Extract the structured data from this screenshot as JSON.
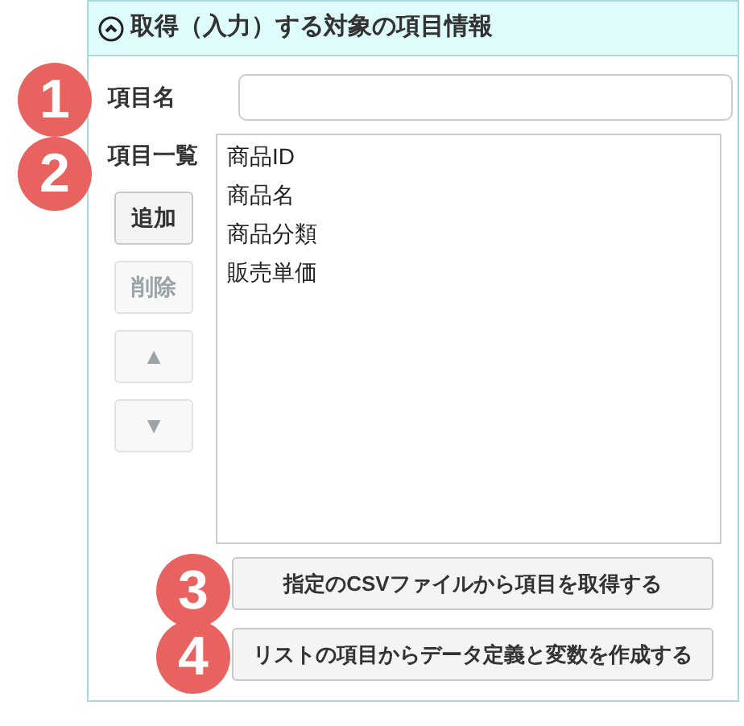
{
  "panel": {
    "title": "取得（入力）する対象の項目情報",
    "expanded": true
  },
  "item_name": {
    "label": "項目名"
  },
  "item_list": {
    "label": "項目一覧",
    "items": [
      "商品ID",
      "商品名",
      "商品分類",
      "販売単価"
    ]
  },
  "list_buttons": [
    {
      "label": "追加",
      "disabled": false
    },
    {
      "label": "削除",
      "disabled": true
    },
    {
      "label": "▲",
      "disabled": true
    },
    {
      "label": "▼",
      "disabled": true
    }
  ],
  "action_buttons": [
    {
      "label": "指定の**CSV**ファイルから項目を取得する",
      "disabled": false
    },
    {
      "label": "リストの項目からデータ定義と変数を作成する",
      "disabled": false
    }
  ],
  "markers": [
    "1",
    "2",
    "3",
    "4"
  ]
}
